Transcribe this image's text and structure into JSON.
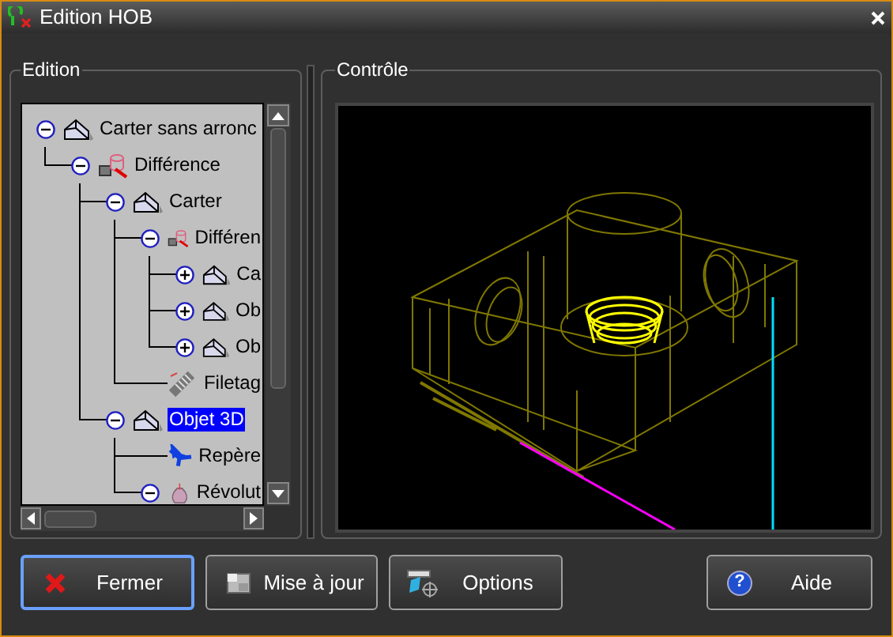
{
  "window": {
    "title": "Edition HOB"
  },
  "edition_panel": {
    "title": "Edition",
    "tree": [
      {
        "label": "Carter sans arronc",
        "kind": "solid",
        "expandable": true,
        "expanded": true,
        "selected": false,
        "children": [
          {
            "label": "Différence",
            "kind": "boolean",
            "expandable": true,
            "expanded": true,
            "selected": false,
            "children": [
              {
                "label": "Carter",
                "kind": "solid",
                "expandable": true,
                "expanded": true,
                "selected": false,
                "children": [
                  {
                    "label": "Différen",
                    "kind": "boolean",
                    "expandable": true,
                    "expanded": true,
                    "selected": false,
                    "children": [
                      {
                        "label": "Ca",
                        "kind": "solid",
                        "expandable": true,
                        "expanded": false,
                        "selected": false
                      },
                      {
                        "label": "Ob",
                        "kind": "solid",
                        "expandable": true,
                        "expanded": false,
                        "selected": false
                      },
                      {
                        "label": "Ob",
                        "kind": "solid",
                        "expandable": true,
                        "expanded": false,
                        "selected": false
                      }
                    ]
                  },
                  {
                    "label": "Filetag",
                    "kind": "thread",
                    "expandable": false,
                    "selected": false
                  }
                ]
              },
              {
                "label": "Objet 3D",
                "kind": "solid",
                "expandable": true,
                "expanded": true,
                "selected": true,
                "children": [
                  {
                    "label": "Repère",
                    "kind": "frame",
                    "expandable": false,
                    "selected": false
                  },
                  {
                    "label": "Révolut",
                    "kind": "revolution",
                    "expandable": true,
                    "expanded": true,
                    "selected": false
                  }
                ]
              }
            ]
          }
        ]
      }
    ]
  },
  "control_panel": {
    "title": "Contrôle"
  },
  "buttons": [
    {
      "label": "Fermer",
      "kind": "close",
      "focused": true
    },
    {
      "label": "Mise à jour",
      "kind": "update",
      "focused": false
    },
    {
      "label": "Options",
      "kind": "options",
      "focused": false
    },
    {
      "label": "Aide",
      "kind": "help",
      "glyph": "?",
      "focused": false
    }
  ]
}
